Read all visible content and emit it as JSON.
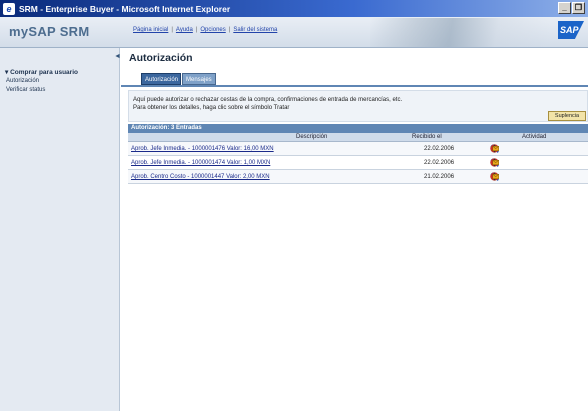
{
  "window": {
    "title": "SRM - Enterprise Buyer - Microsoft Internet Explorer",
    "minimize_label": "_",
    "restore_label": "❐",
    "ie_glyph": "e"
  },
  "header": {
    "brand": "mySAP SRM",
    "links": [
      "Página inicial",
      "Ayuda",
      "Opciones",
      "Salir del sistema"
    ],
    "separator": "|",
    "logo": "SAP"
  },
  "nav": {
    "collapse_glyph": "◄",
    "group": "▾ Comprar para usuario",
    "items": [
      "Autorización",
      "Verificar status"
    ]
  },
  "main": {
    "title": "Autorización",
    "tabs": [
      "Autorización",
      "Mensajes"
    ],
    "info": [
      "Aquí puede autorizar o rechazar cestas de la compra, confirmaciones de entrada de mercancías, etc.",
      "Para obtener los detalles, haga clic sobre el símbolo Tratar"
    ],
    "suplencia_label": "Suplencia"
  },
  "table": {
    "title": "Autorización: 3 Entradas",
    "columns": [
      "Descripción",
      "Recibido el",
      "Actividad"
    ],
    "rows": [
      {
        "desc": "Aprob. Jefe Inmedia. - 1000001476 Valor: 16,00 MXN",
        "date": "22.02.2006"
      },
      {
        "desc": "Aprob. Jefe Inmedia. - 1000001474 Valor: 1,00 MXN",
        "date": "22.02.2006"
      },
      {
        "desc": "Aprob. Centro Costo - 1000001447 Valor: 2,00 MXN",
        "date": "21.02.2006"
      }
    ],
    "action_icons": [
      "magnifier-icon",
      "approve-check-icon",
      "reject-x-icon",
      "exchange-arrows-icon",
      "forward-envelope-icon"
    ]
  },
  "colors": {
    "table_header": "#5f86b4",
    "approve": "#2e9a3a",
    "reject": "#d22a2a",
    "magnifier": "#2a4fb0"
  }
}
